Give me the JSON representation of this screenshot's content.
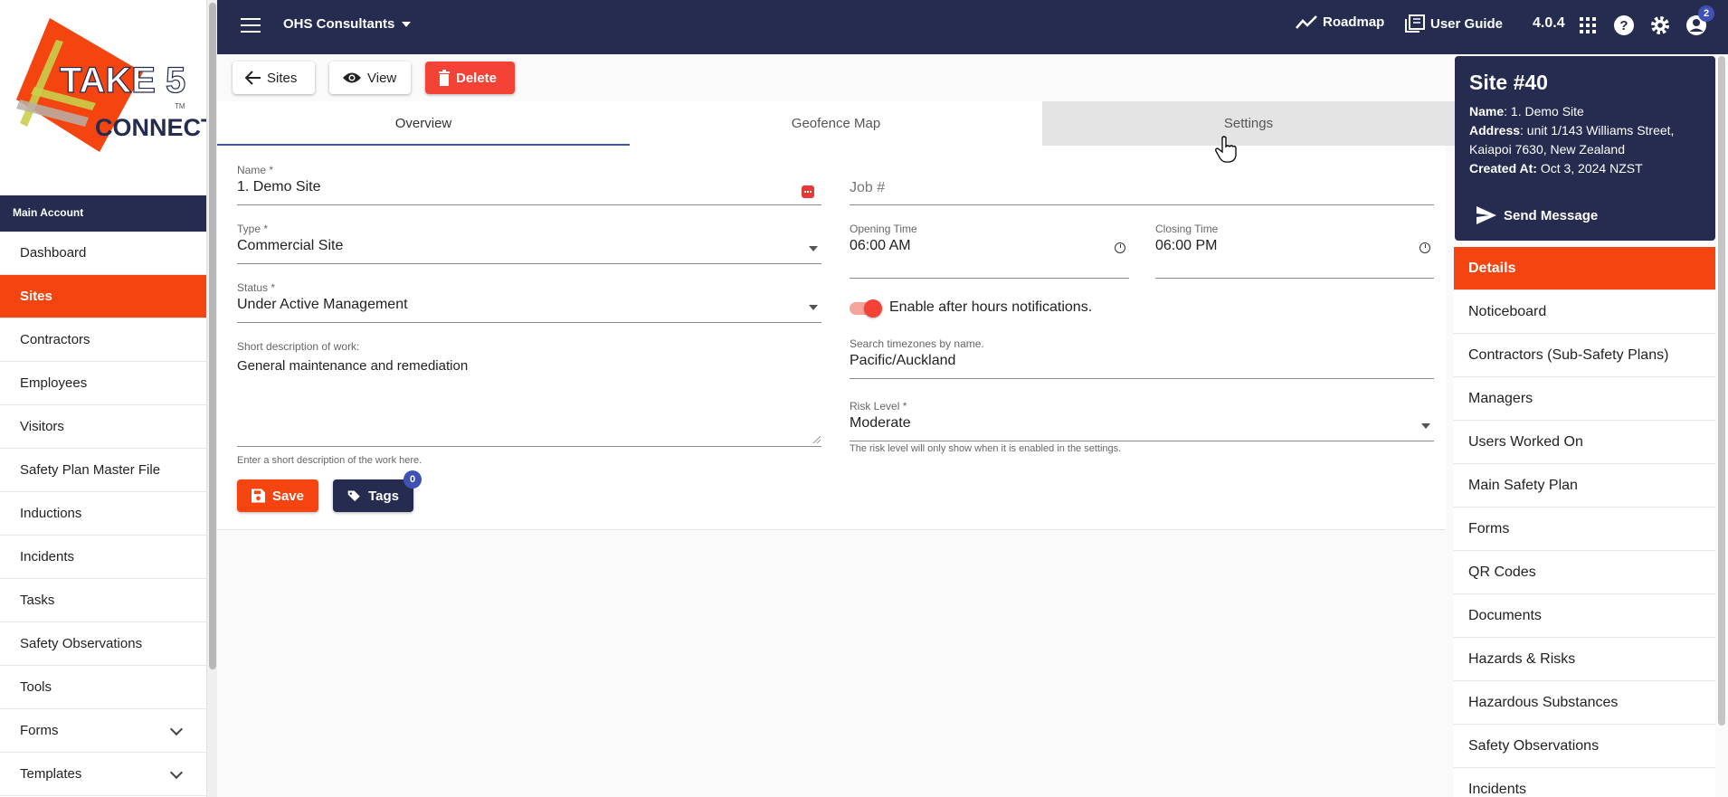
{
  "app": {
    "logo_text_1": "TAKE 5",
    "logo_text_2": "CONNECT",
    "logo_tm": "TM"
  },
  "topbar": {
    "org_name": "OHS Consultants",
    "roadmap_label": "Roadmap",
    "user_guide_label": "User Guide",
    "version": "4.0.4",
    "notification_count": "2"
  },
  "sidebar": {
    "section_title": "Main Account",
    "items": [
      {
        "label": "Dashboard"
      },
      {
        "label": "Sites",
        "active": true
      },
      {
        "label": "Contractors"
      },
      {
        "label": "Employees"
      },
      {
        "label": "Visitors"
      },
      {
        "label": "Safety Plan Master File"
      },
      {
        "label": "Inductions"
      },
      {
        "label": "Incidents"
      },
      {
        "label": "Tasks"
      },
      {
        "label": "Safety Observations"
      },
      {
        "label": "Tools"
      },
      {
        "label": "Forms",
        "expandable": true
      },
      {
        "label": "Templates",
        "expandable": true
      }
    ]
  },
  "actions": {
    "back_label": "Sites",
    "view_label": "View",
    "delete_label": "Delete"
  },
  "tabs": {
    "overview": "Overview",
    "geofence": "Geofence Map",
    "settings": "Settings",
    "selected": "Overview"
  },
  "form": {
    "name": {
      "label": "Name *",
      "value": "1. Demo Site"
    },
    "job": {
      "placeholder": "Job #"
    },
    "type": {
      "label": "Type *",
      "value": "Commercial Site"
    },
    "opening": {
      "label": "Opening Time",
      "value": "06:00 AM"
    },
    "closing": {
      "label": "Closing Time",
      "value": "06:00 PM"
    },
    "status": {
      "label": "Status *",
      "value": "Under Active Management"
    },
    "after_hours": {
      "label": "Enable after hours notifications.",
      "enabled": true
    },
    "description": {
      "label": "Short description of work:",
      "value": "General maintenance and remediation",
      "hint": "Enter a short description of the work here."
    },
    "timezone": {
      "label": "Search timezones by name.",
      "value": "Pacific/Auckland"
    },
    "risk": {
      "label": "Risk Level *",
      "value": "Moderate",
      "hint": "The risk level will only show when it is enabled in the settings."
    },
    "save_label": "Save",
    "tags_label": "Tags",
    "tags_count": "0"
  },
  "site_card": {
    "title": "Site #40",
    "name_label": "Name",
    "name_value": ": 1. Demo Site",
    "address_label": "Address",
    "address_value": ": unit 1/143 Williams Street, Kaiapoi 7630, New Zealand",
    "created_label": "Created At:",
    "created_value": " Oct 3, 2024 NZST",
    "send_label": "Send Message"
  },
  "right_menu": [
    {
      "label": "Details",
      "active": true
    },
    {
      "label": "Noticeboard"
    },
    {
      "label": "Contractors (Sub-Safety Plans)"
    },
    {
      "label": "Managers"
    },
    {
      "label": "Users Worked On"
    },
    {
      "label": "Main Safety Plan"
    },
    {
      "label": "Forms"
    },
    {
      "label": "QR Codes"
    },
    {
      "label": "Documents"
    },
    {
      "label": "Hazards & Risks"
    },
    {
      "label": "Hazardous Substances"
    },
    {
      "label": "Safety Observations"
    },
    {
      "label": "Incidents"
    }
  ],
  "colors": {
    "navy": "#252c4f",
    "brand_orange": "#f4440f",
    "delete_red": "#f44336",
    "accent_blue": "#3f51b5"
  }
}
